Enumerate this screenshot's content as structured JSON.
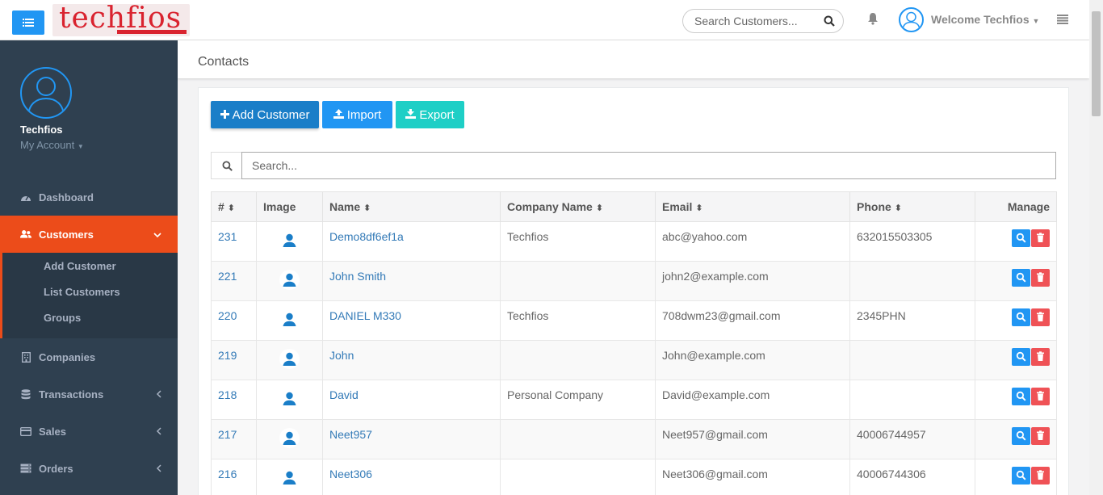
{
  "header": {
    "logo_text": "techfios",
    "search_placeholder": "Search Customers...",
    "welcome": "Welcome Techfios"
  },
  "sidebar": {
    "profile_name": "Techfios",
    "profile_account": "My Account",
    "items": [
      {
        "label": "Dashboard",
        "icon": "dashboard-icon"
      },
      {
        "label": "Customers",
        "icon": "users-icon",
        "active": true
      },
      {
        "label": "Companies",
        "icon": "building-icon"
      },
      {
        "label": "Transactions",
        "icon": "database-icon"
      },
      {
        "label": "Sales",
        "icon": "credit-card-icon"
      },
      {
        "label": "Orders",
        "icon": "server-icon"
      }
    ],
    "submenu": [
      "Add Customer",
      "List Customers",
      "Groups"
    ]
  },
  "page": {
    "title": "Contacts"
  },
  "toolbar": {
    "add": "Add Customer",
    "import": "Import",
    "export": "Export"
  },
  "table": {
    "search_placeholder": "Search...",
    "columns": [
      "#",
      "Image",
      "Name",
      "Company Name",
      "Email",
      "Phone",
      "Manage"
    ],
    "rows": [
      {
        "id": "231",
        "name": "Demo8df6ef1a",
        "company": "Techfios",
        "email": "abc@yahoo.com",
        "phone": "632015503305"
      },
      {
        "id": "221",
        "name": "John Smith",
        "company": "",
        "email": "john2@example.com",
        "phone": ""
      },
      {
        "id": "220",
        "name": "DANIEL M330",
        "company": "Techfios",
        "email": "708dwm23@gmail.com",
        "phone": "2345PHN"
      },
      {
        "id": "219",
        "name": "John",
        "company": "",
        "email": "John@example.com",
        "phone": ""
      },
      {
        "id": "218",
        "name": "David",
        "company": "Personal Company",
        "email": "David@example.com",
        "phone": ""
      },
      {
        "id": "217",
        "name": "Neet957",
        "company": "",
        "email": "Neet957@gmail.com",
        "phone": "40006744957"
      },
      {
        "id": "216",
        "name": "Neet306",
        "company": "",
        "email": "Neet306@gmail.com",
        "phone": "40006744306"
      }
    ]
  },
  "colors": {
    "sidebar_bg": "#2f4050",
    "active": "#ec4c1a",
    "primary": "#2196f3",
    "add_button": "#1a7ec8",
    "export_button": "#1ecfc6",
    "delete": "#ef5256"
  }
}
